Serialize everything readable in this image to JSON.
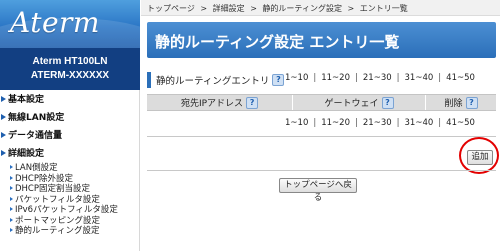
{
  "logo": {
    "text": "Aterm"
  },
  "device": {
    "line1": "Aterm   HT100LN",
    "line2": "ATERM-XXXXXX"
  },
  "nav": {
    "main_items": [
      {
        "label": "基本設定"
      },
      {
        "label": "無線LAN設定"
      },
      {
        "label": "データ通信量"
      },
      {
        "label": "詳細設定"
      }
    ],
    "sub_items": [
      {
        "label": "LAN側設定"
      },
      {
        "label": "DHCP除外設定"
      },
      {
        "label": "DHCP固定割当設定"
      },
      {
        "label": "パケットフィルタ設定"
      },
      {
        "label": "IPv6パケットフィルタ設定"
      },
      {
        "label": "ポートマッピング設定"
      },
      {
        "label": "静的ルーティング設定"
      }
    ]
  },
  "breadcrumb": {
    "items": [
      "トップページ",
      "詳細設定",
      "静的ルーティング設定",
      "エントリ一覧"
    ],
    "separator": ">"
  },
  "page_title": "静的ルーティング設定 エントリ一覧",
  "entry_section": {
    "label": "静的ルーティングエントリ",
    "help": "?"
  },
  "pager": {
    "ranges": [
      "1~10",
      "11~20",
      "21~30",
      "31~40",
      "41~50"
    ],
    "separator": "|"
  },
  "table": {
    "columns": [
      {
        "label": "宛先IPアドレス",
        "help": "?"
      },
      {
        "label": "ゲートウェイ",
        "help": "?"
      },
      {
        "label": "削除",
        "help": "?"
      }
    ]
  },
  "buttons": {
    "add": "追加",
    "back_to_top": "トップページへ戻る"
  },
  "colors": {
    "brand_blue": "#2b6fb9",
    "model_bg": "#123f82",
    "highlight_red": "#e30000"
  }
}
